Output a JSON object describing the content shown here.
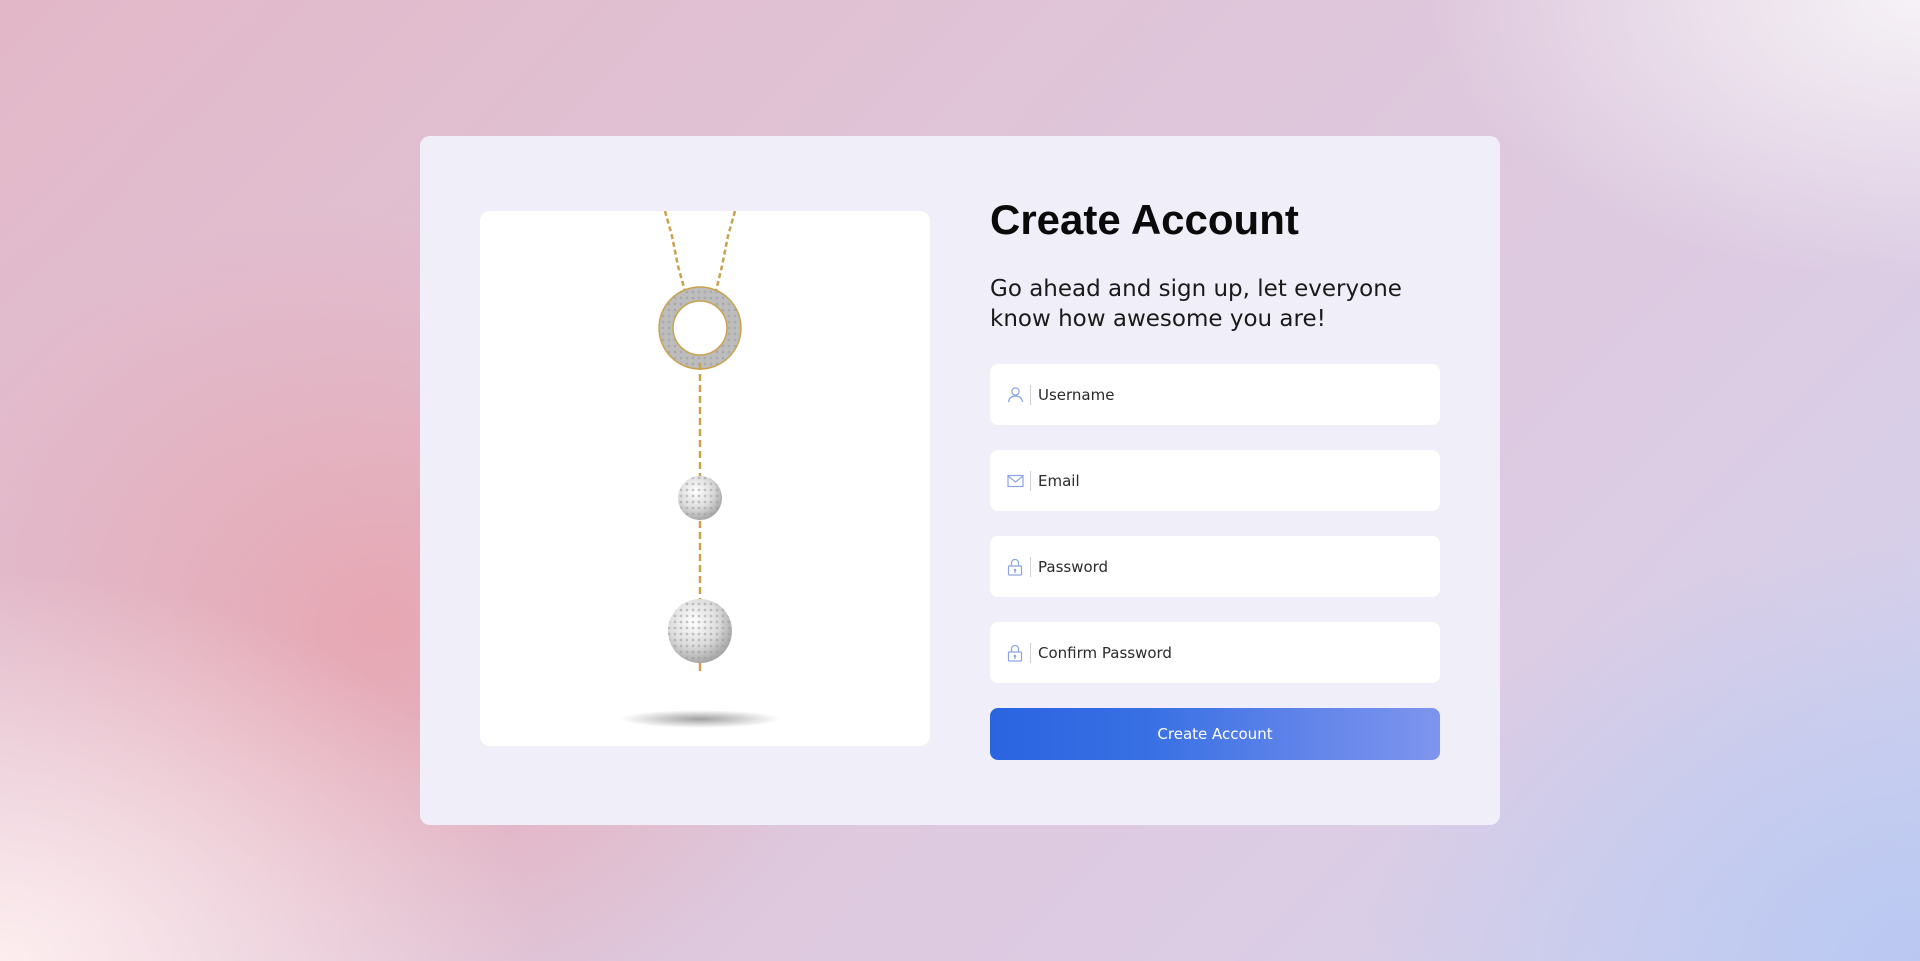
{
  "colors": {
    "card_background": "#f0eef8",
    "accent": "#2a64e0",
    "icon": "#8aa4e0"
  },
  "product_image": {
    "icon": "necklace-image"
  },
  "form": {
    "title": "Create Account",
    "subtitle": "Go ahead and sign up, let everyone know how awesome you are!",
    "fields": [
      {
        "icon": "user-icon",
        "placeholder": "Username",
        "value": ""
      },
      {
        "icon": "mail-icon",
        "placeholder": "Email",
        "value": ""
      },
      {
        "icon": "lock-icon",
        "placeholder": "Password",
        "value": ""
      },
      {
        "icon": "lock-icon",
        "placeholder": "Confirm Password",
        "value": ""
      }
    ],
    "submit_label": "Create Account"
  }
}
